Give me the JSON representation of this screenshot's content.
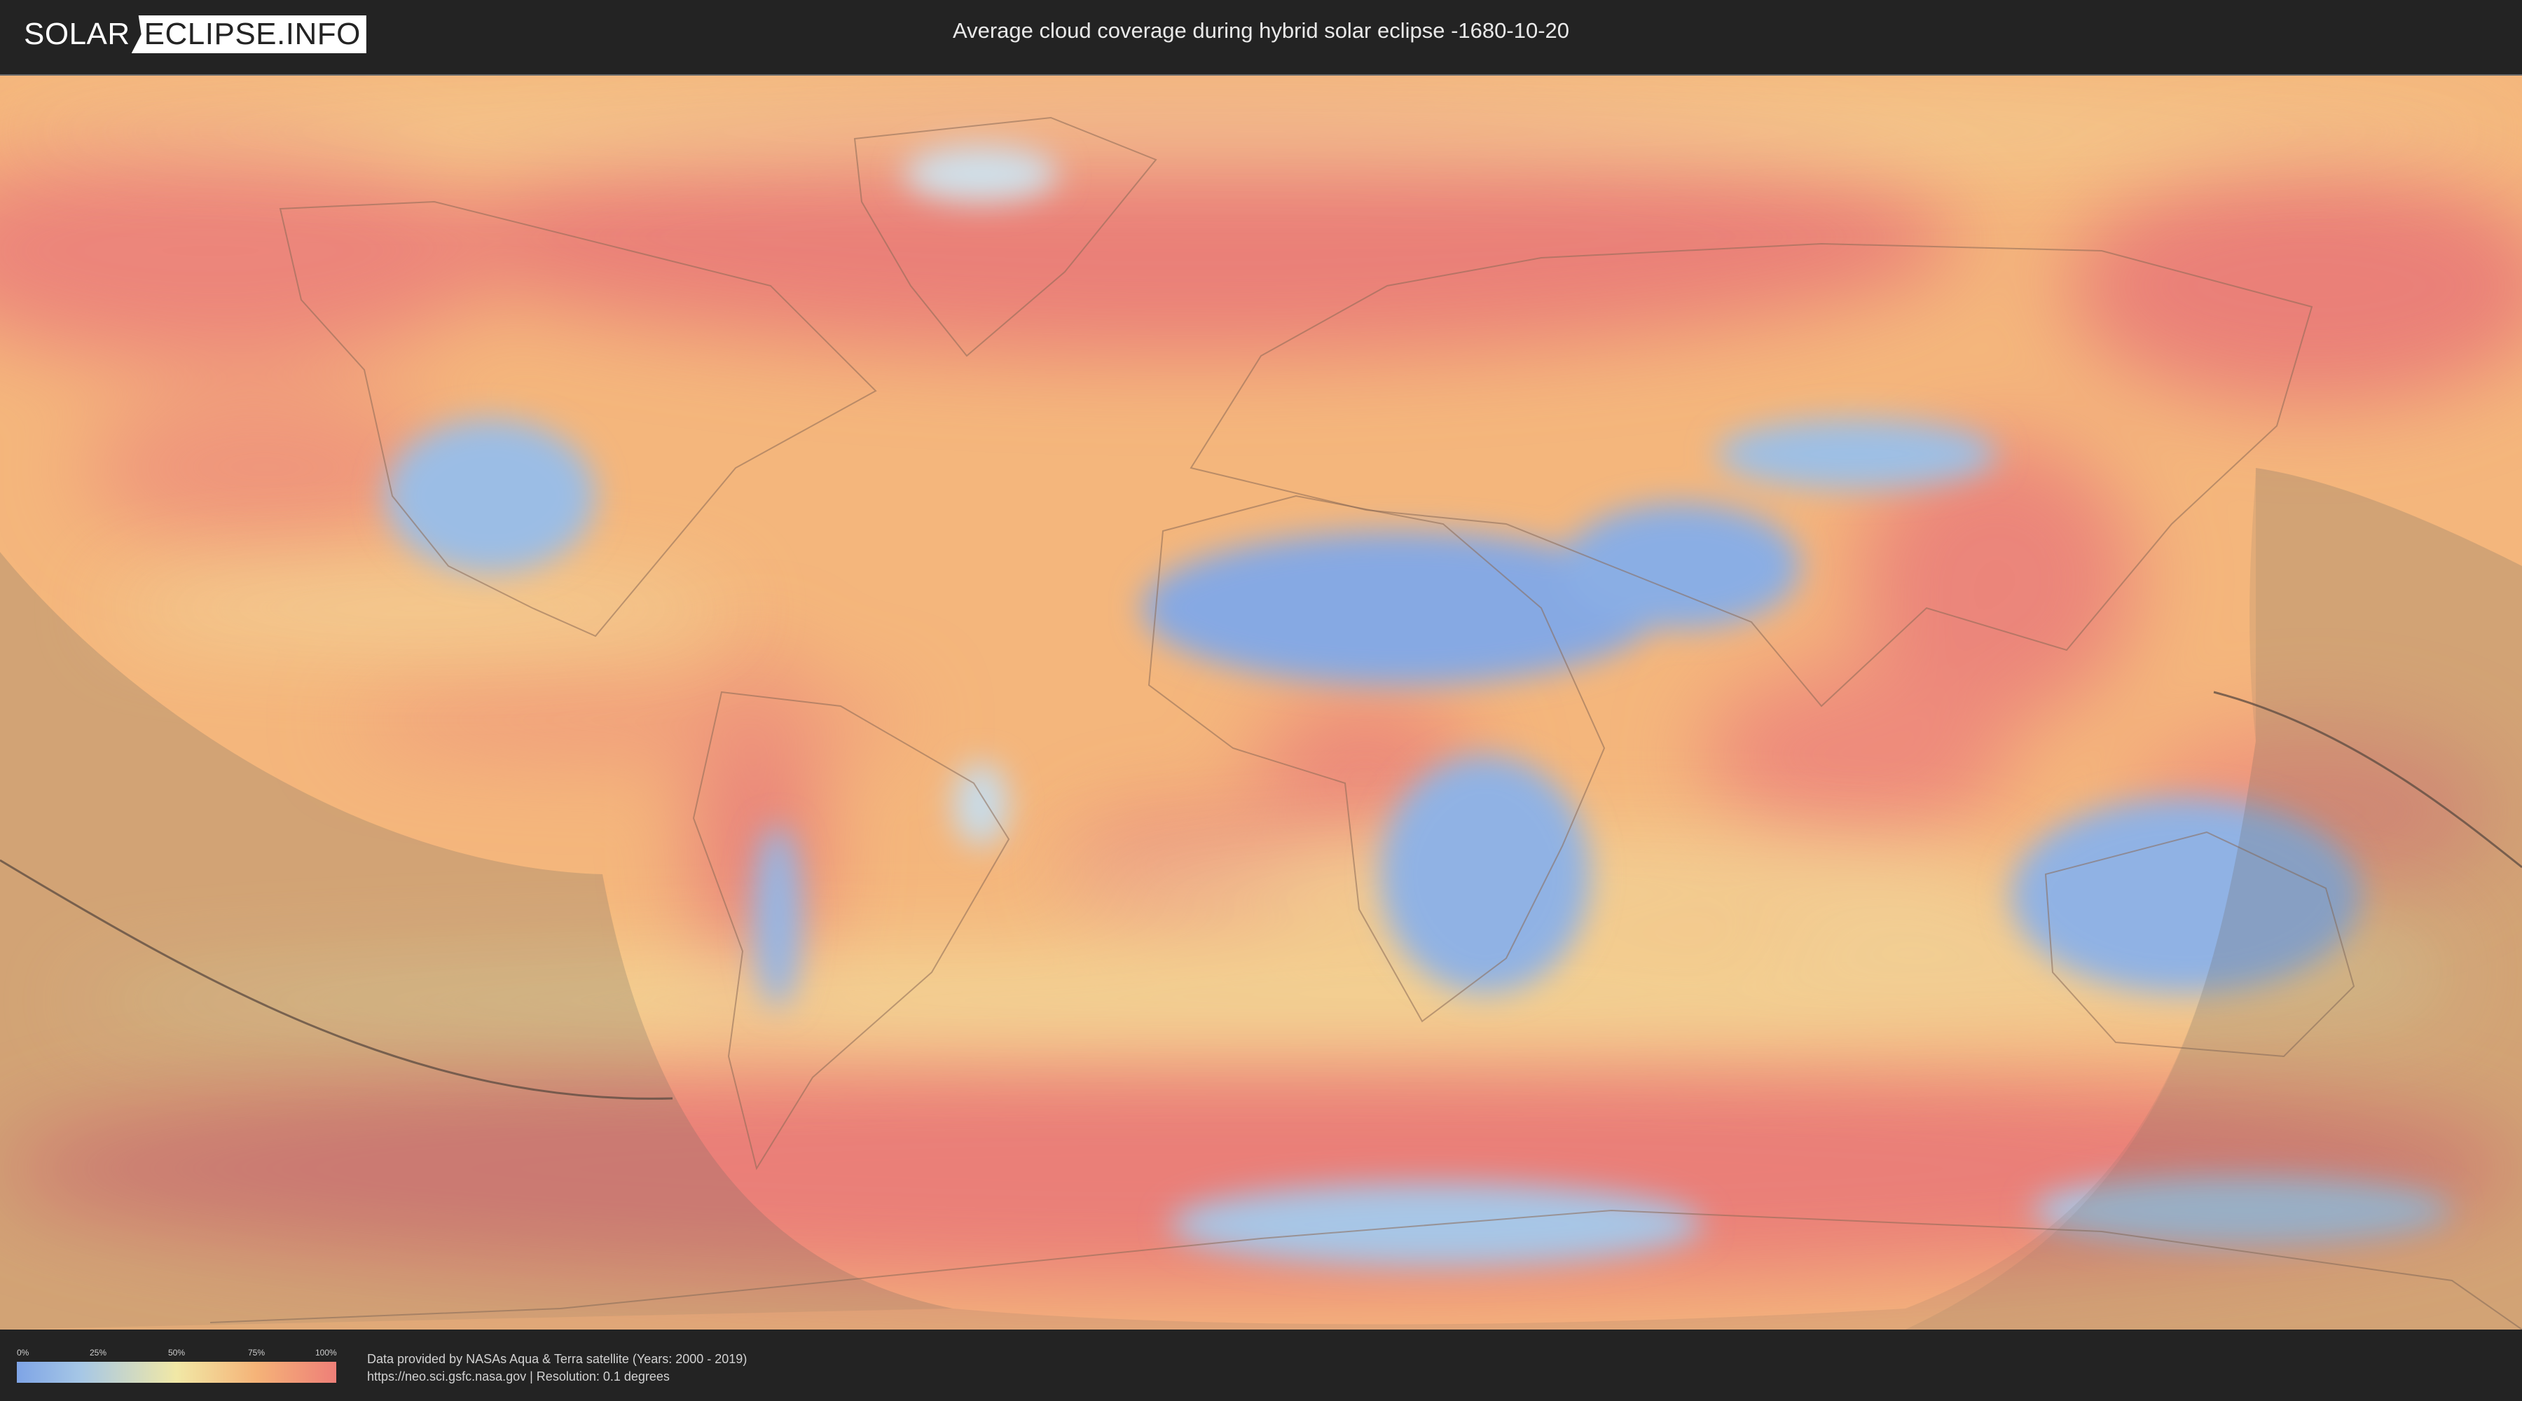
{
  "header": {
    "logo_left": "SOLAR",
    "logo_right": "ECLIPSE.INFO",
    "title": "Average cloud coverage during hybrid solar eclipse -1680-10-20"
  },
  "map": {
    "layer": "average cloud coverage",
    "eclipse_date": "-1680-10-20",
    "eclipse_type": "hybrid"
  },
  "legend": {
    "ticks": [
      "0%",
      "25%",
      "50%",
      "75%",
      "100%"
    ],
    "colors": [
      "#7ea4e6",
      "#a6c7e6",
      "#f1e8a6",
      "#f5b378",
      "#ee7f78"
    ]
  },
  "footer": {
    "source_line": "Data provided by NASAs Aqua & Terra satellite (Years: 2000 - 2019)",
    "url_line": "https://neo.sci.gsfc.nasa.gov | Resolution: 0.1 degrees"
  }
}
